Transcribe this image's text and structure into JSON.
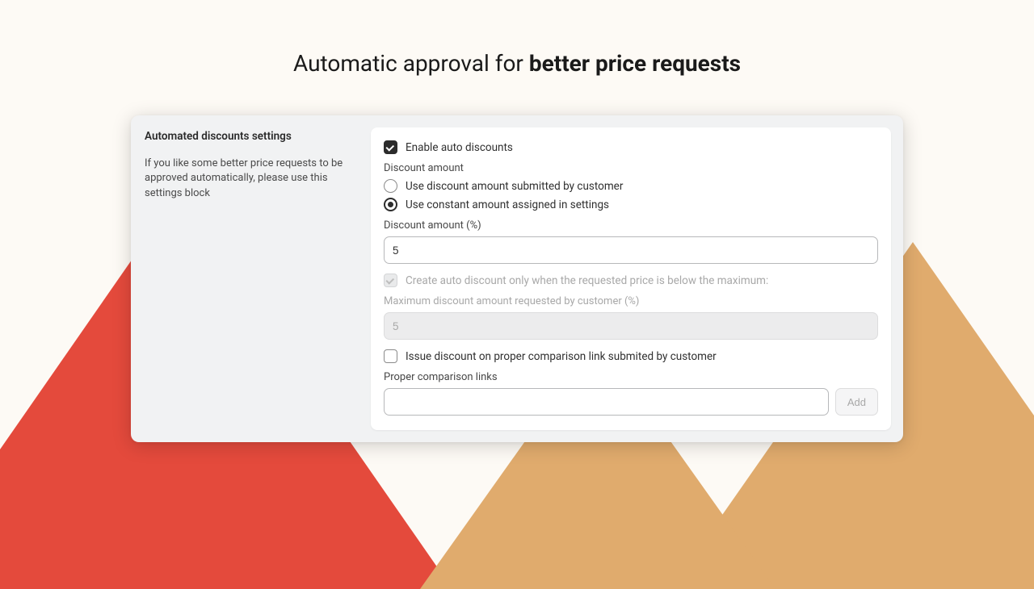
{
  "header": {
    "title_prefix": "Automatic approval for ",
    "title_bold": "better price requests"
  },
  "sidebar": {
    "heading": "Automated discounts settings",
    "description": "If you like some better price requests to be approved automatically, please use this settings block"
  },
  "panel": {
    "enable_auto_discounts_label": "Enable auto discounts",
    "discount_amount_heading": "Discount amount",
    "radio_customer_label": "Use discount amount submitted by customer",
    "radio_constant_label": "Use constant amount assigned in settings",
    "discount_amount_pct_label": "Discount amount (%)",
    "discount_amount_value": "5",
    "only_below_max_label": "Create auto discount only when the requested price is below the maximum:",
    "max_requested_label": "Maximum discount amount requested by customer (%)",
    "max_requested_value": "5",
    "issue_on_link_label": "Issue discount on proper comparison link submited by customer",
    "proper_links_label": "Proper comparison links",
    "proper_link_value": "",
    "add_button_label": "Add"
  }
}
